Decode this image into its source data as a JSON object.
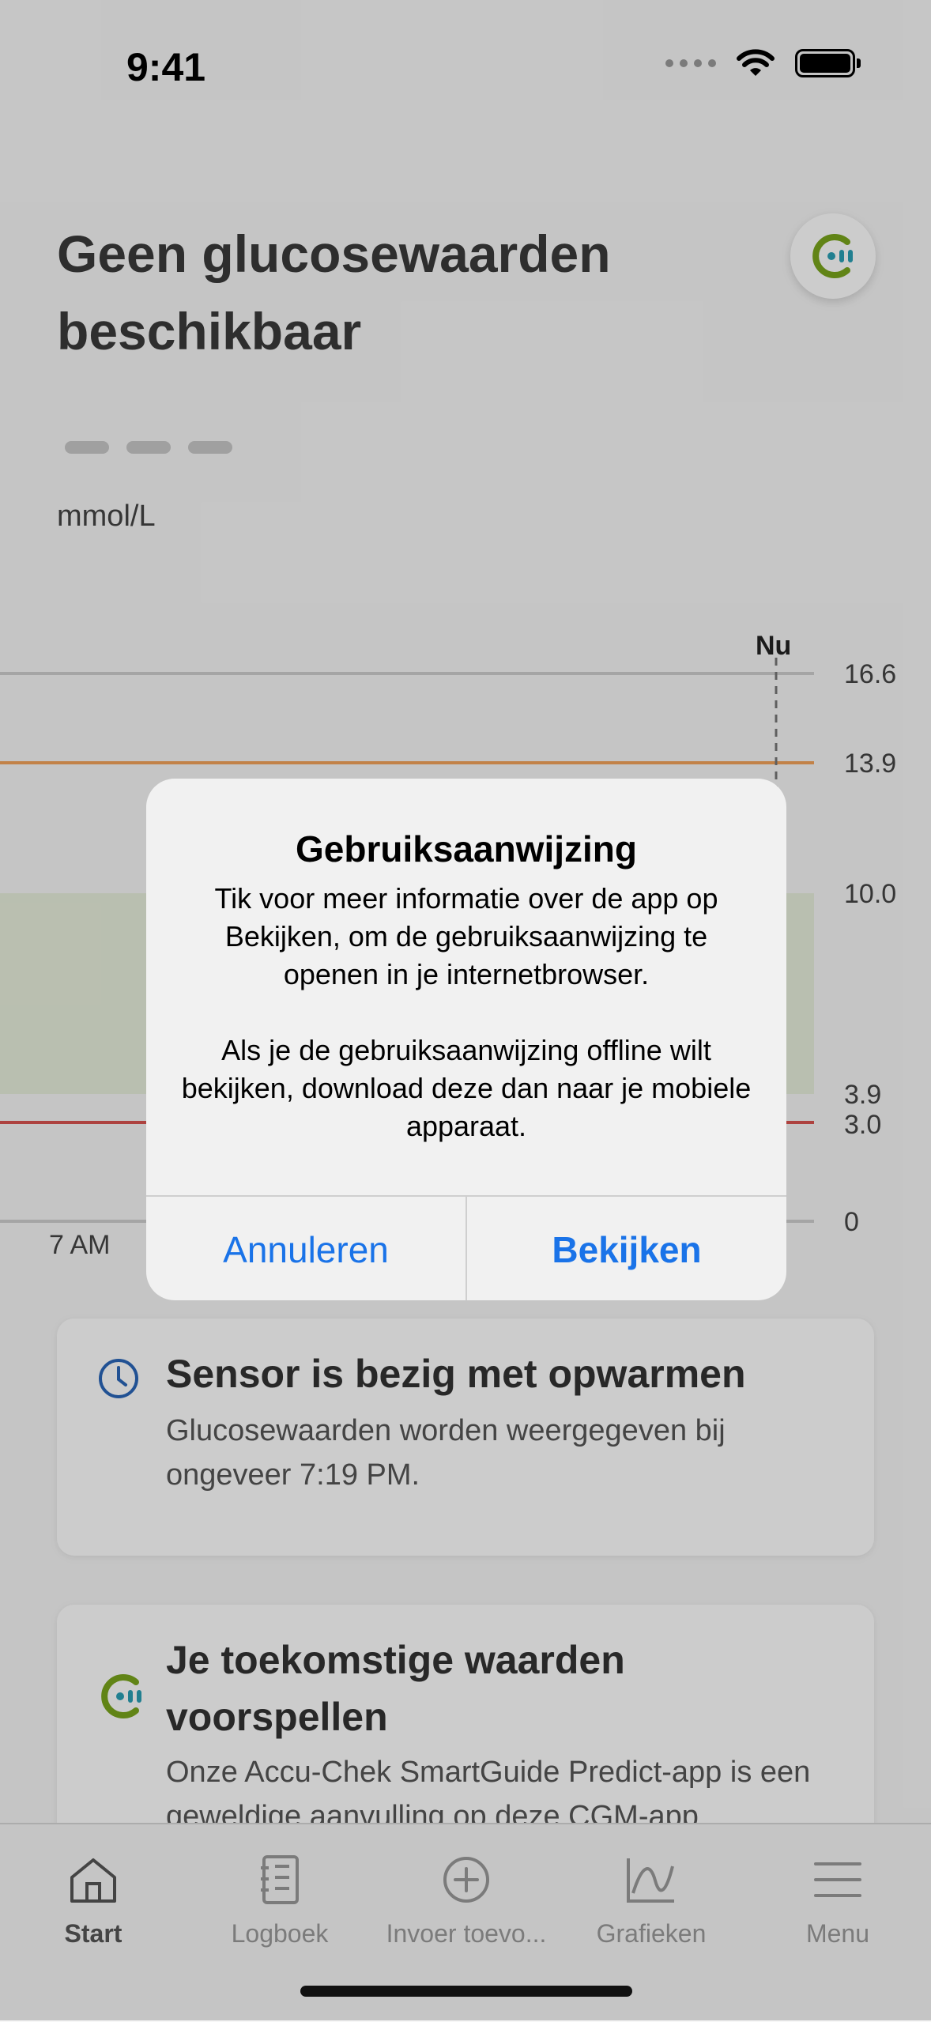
{
  "status": {
    "time": "9:41"
  },
  "header": {
    "title": "Geen glucosewaarden beschikbaar",
    "unit": "mmol/L"
  },
  "chart": {
    "now_label": "Nu",
    "y_ticks": [
      "16.6",
      "13.9",
      "10.0",
      "3.9",
      "3.0",
      "0"
    ],
    "x_label": "7 AM",
    "colors": {
      "high_line": "#f3a35a",
      "low_line": "#d9534f",
      "target_band": "#e8efdc"
    }
  },
  "cards": [
    {
      "icon": "clock-icon",
      "title": "Sensor is bezig met opwarmen",
      "body": "Glucosewaarden worden weergegeven bij ongeveer 7:19 PM."
    },
    {
      "icon": "smartguide-logo-icon",
      "title": "Je toekomstige waarden voorspellen",
      "body": "Onze Accu-Chek SmartGuide Predict-app is een geweldige aanvulling op deze CGM-app"
    }
  ],
  "tabs": [
    {
      "label": "Start",
      "icon": "home-icon"
    },
    {
      "label": "Logboek",
      "icon": "logbook-icon"
    },
    {
      "label": "Invoer toevo...",
      "icon": "add-entry-icon"
    },
    {
      "label": "Grafieken",
      "icon": "charts-icon"
    },
    {
      "label": "Menu",
      "icon": "menu-icon"
    }
  ],
  "alert": {
    "title": "Gebruiksaanwijzing",
    "message_1": "Tik voor meer informatie over de app op Bekijken, om de gebruiksaanwijzing te openen in je internetbrowser.",
    "message_2": "Als je de gebruiksaanwijzing offline wilt bekijken, download deze dan naar je mobiele apparaat.",
    "cancel": "Annuleren",
    "confirm": "Bekijken",
    "accent": "#1a73e8"
  }
}
